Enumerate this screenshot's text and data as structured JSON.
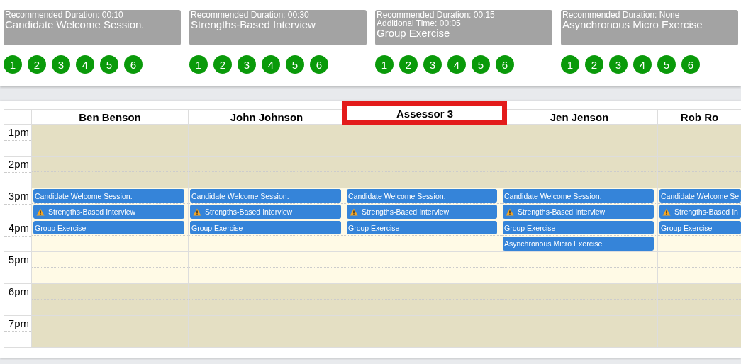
{
  "activities": [
    {
      "details": [
        "Recommended Duration: 00:10"
      ],
      "title": "Candidate Welcome Session.",
      "slots": [
        "1",
        "2",
        "3",
        "4",
        "5",
        "6"
      ]
    },
    {
      "details": [
        "Recommended Duration: 00:30"
      ],
      "title": "Strengths-Based Interview",
      "slots": [
        "1",
        "2",
        "3",
        "4",
        "5",
        "6"
      ]
    },
    {
      "details": [
        "Recommended Duration: 00:15",
        "Additional Time: 00:05"
      ],
      "title": "Group Exercise",
      "slots": [
        "1",
        "2",
        "3",
        "4",
        "5",
        "6"
      ]
    },
    {
      "details": [
        "Recommended Duration: None"
      ],
      "title": "Asynchronous Micro Exercise",
      "slots": [
        "1",
        "2",
        "3",
        "4",
        "5",
        "6"
      ]
    }
  ],
  "calendar": {
    "hours": [
      {
        "label": "1pm",
        "working": false
      },
      {
        "label": "2pm",
        "working": false
      },
      {
        "label": "3pm",
        "working": true
      },
      {
        "label": "4pm",
        "working": true
      },
      {
        "label": "5pm",
        "working": true
      },
      {
        "label": "6pm",
        "working": false
      },
      {
        "label": "7pm",
        "working": false
      }
    ],
    "columns": [
      {
        "name": "Ben Benson",
        "highlighted": false,
        "events": [
          {
            "title": "Candidate Welcome Session.",
            "warning": false
          },
          {
            "title": "Strengths-Based Interview",
            "warning": true
          },
          {
            "title": "Group Exercise",
            "warning": false
          }
        ]
      },
      {
        "name": "John Johnson",
        "highlighted": false,
        "events": [
          {
            "title": "Candidate Welcome Session.",
            "warning": false
          },
          {
            "title": "Strengths-Based Interview",
            "warning": true
          },
          {
            "title": "Group Exercise",
            "warning": false
          }
        ]
      },
      {
        "name": "Assessor 3",
        "highlighted": true,
        "events": [
          {
            "title": "Candidate Welcome Session.",
            "warning": false
          },
          {
            "title": "Strengths-Based Interview",
            "warning": true
          },
          {
            "title": "Group Exercise",
            "warning": false
          }
        ]
      },
      {
        "name": "Jen Jenson",
        "highlighted": false,
        "events": [
          {
            "title": "Candidate Welcome Session.",
            "warning": false
          },
          {
            "title": "Strengths-Based Interview",
            "warning": true
          },
          {
            "title": "Group Exercise",
            "warning": false
          },
          {
            "title": "Asynchronous Micro Exercise",
            "warning": false
          }
        ]
      },
      {
        "name": "Rob Ro",
        "highlighted": false,
        "events": [
          {
            "title": "Candidate Welcome Se",
            "warning": false
          },
          {
            "title": "Strengths-Based In",
            "warning": true
          },
          {
            "title": "Group Exercise",
            "warning": false
          }
        ]
      }
    ]
  }
}
